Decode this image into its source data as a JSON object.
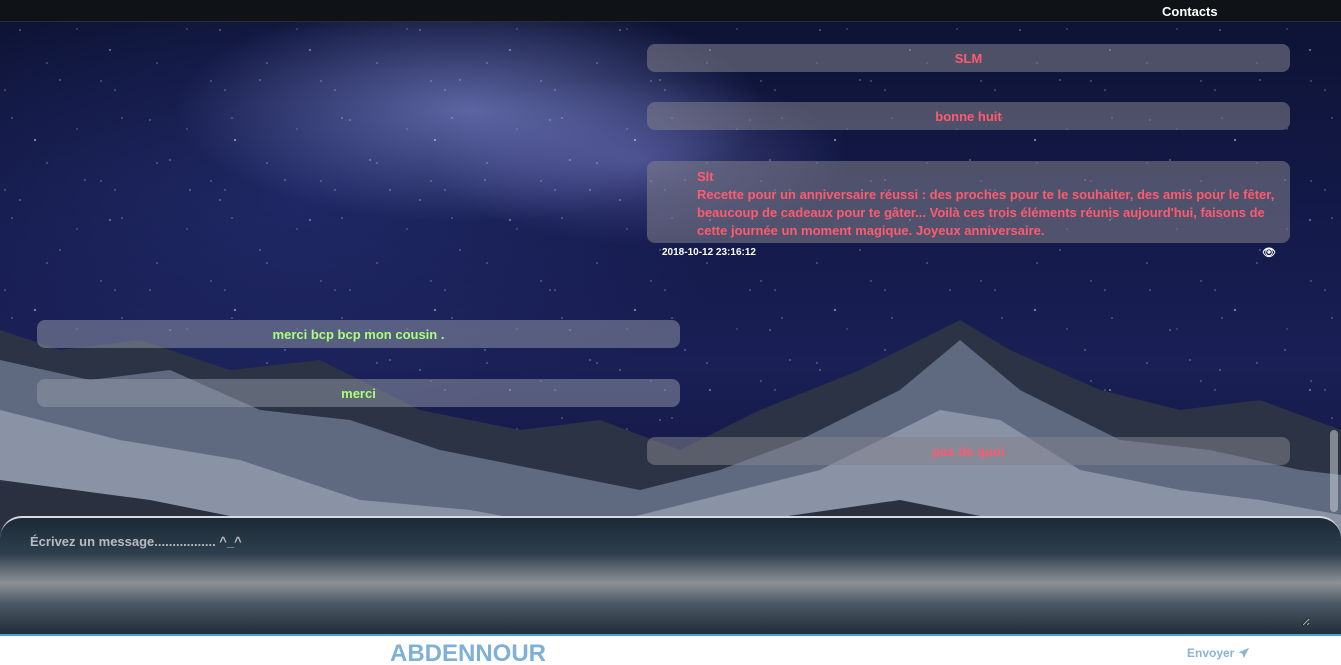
{
  "header": {
    "contacts_label": "Contacts"
  },
  "messages": [
    {
      "side": "right",
      "text": "SLM"
    },
    {
      "side": "right",
      "text": "bonne huit"
    },
    {
      "side": "right",
      "lines": [
        "Slt",
        "Recette pour un anniversaire réussi : des proches pour te le souhaiter, des amis pour le fêter,",
        "beaucoup de cadeaux pour te gâter... Voilà ces trois éléments réunis aujourd'hui, faisons de",
        "cette journée un moment magique. Joyeux anniversaire."
      ],
      "timestamp": "2018-10-12 23:16:12"
    },
    {
      "side": "left",
      "text": "merci bcp bcp mon cousin ."
    },
    {
      "side": "left",
      "text": "merci"
    },
    {
      "side": "right",
      "text": "pas de quoi"
    }
  ],
  "composer": {
    "placeholder": "Écrivez un message................. ^_^",
    "value": ""
  },
  "footer": {
    "username": "ABDENNOUR",
    "send_label": "Envoyer"
  },
  "colors": {
    "outgoing_text": "#ff5a6e",
    "incoming_text": "#a8ff7a",
    "accent": "#4aa3d8"
  },
  "icons": {
    "seen": "eye-icon",
    "send": "paper-plane-icon"
  }
}
